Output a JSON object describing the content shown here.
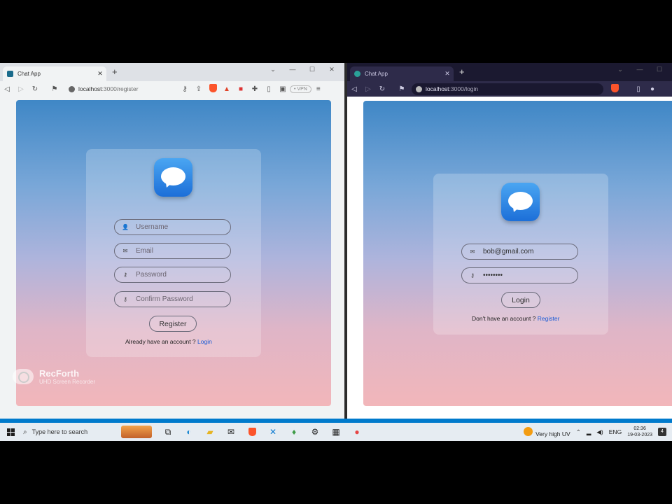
{
  "left_browser": {
    "tab_title": "Chat App",
    "url_host": "localhost",
    "url_path": ":3000/register",
    "vpn_label": "• VPN",
    "register_form": {
      "username_placeholder": "Username",
      "email_placeholder": "Email",
      "password_placeholder": "Password",
      "confirm_password_placeholder": "Confirm Password",
      "submit_label": "Register",
      "login_prompt": "Already have an account ?",
      "login_link": "Login"
    },
    "watermark": {
      "title": "RecForth",
      "subtitle": "UHD Screen Recorder"
    }
  },
  "right_browser": {
    "tab_title": "Chat App",
    "url_host": "localhost",
    "url_path": ":3000/login",
    "login_form": {
      "email_value": "bob@gmail.com",
      "password_value": "••••••••",
      "submit_label": "Login",
      "register_prompt": "Don't have an account ?",
      "register_link": "Register"
    }
  },
  "taskbar": {
    "search_placeholder": "Type here to search",
    "weather": "Very high UV",
    "language": "ENG",
    "time": "02:36",
    "date": "19-03-2023",
    "notification_count": "4"
  },
  "colors": {
    "accent_link": "#1a5bd6",
    "gradient_top": "#3f87c6",
    "gradient_bottom": "#f2b6ba",
    "vscode_status": "#007acc"
  }
}
